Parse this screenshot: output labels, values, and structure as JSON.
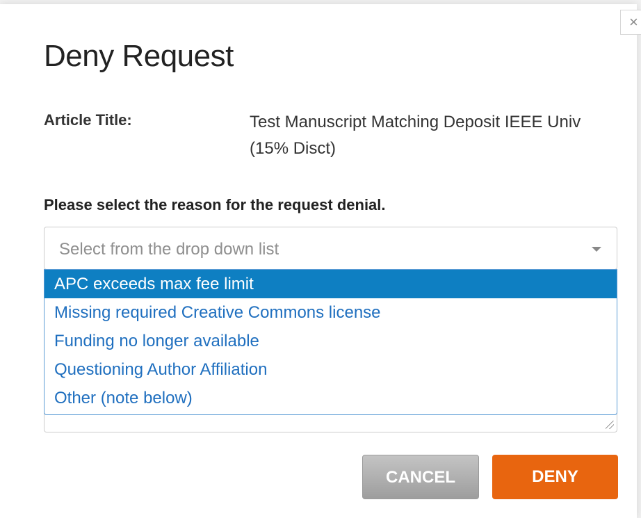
{
  "dialog": {
    "title": "Deny Request",
    "close_label": "×",
    "article_title_label": "Article Title:",
    "article_title_value": "Test Manuscript Matching Deposit IEEE Univ (15% Disct)",
    "reason_prompt": "Please select the reason for the request denial."
  },
  "reason_select": {
    "placeholder": "Select from the drop down list",
    "options": [
      "APC exceeds max fee limit",
      "Missing required Creative Commons license",
      "Funding no longer available",
      "Questioning Author Affiliation",
      "Other (note below)"
    ],
    "highlighted_index": 0
  },
  "buttons": {
    "cancel_label": "CANCEL",
    "deny_label": "DENY"
  },
  "colors": {
    "deny_button": "#e8650f",
    "highlight": "#0e7fc2",
    "option_text": "#1f6fbf"
  }
}
